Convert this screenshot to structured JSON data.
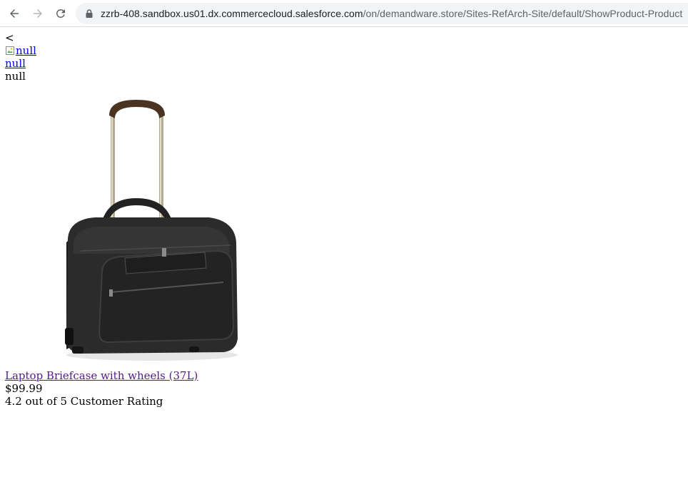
{
  "browser": {
    "url_host": "zzrb-408.sandbox.us01.dx.commercecloud.salesforce.com",
    "url_path": "/on/demandware.store/Sites-RefArch-Site/default/ShowProduct-Product"
  },
  "page": {
    "back_link": "<",
    "image_alt": "null",
    "link_text": "null",
    "plain_text": "null"
  },
  "product": {
    "name": "Laptop Briefcase with wheels (37L)",
    "price": "$99.99",
    "rating": "4.2 out of 5 Customer Rating",
    "image_icon": "rolling-briefcase-image"
  }
}
